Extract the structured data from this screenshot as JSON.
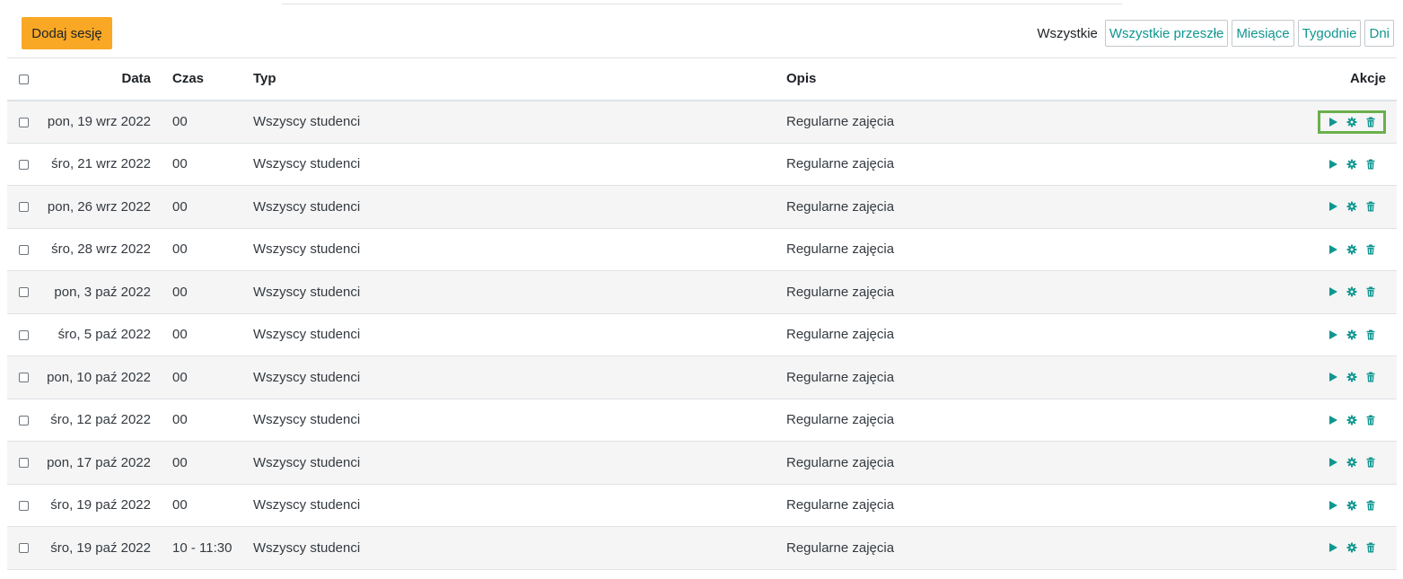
{
  "toolbar": {
    "add_session_label": "Dodaj sesję"
  },
  "filters": {
    "label": "Wszystkie",
    "buttons": [
      "Wszystkie przeszłe",
      "Miesiące",
      "Tygodnie",
      "Dni"
    ]
  },
  "table": {
    "headers": {
      "date": "Data",
      "time": "Czas",
      "type": "Typ",
      "description": "Opis",
      "actions": "Akcje"
    },
    "rows": [
      {
        "date": "pon, 19 wrz 2022",
        "time": "00",
        "type": "Wszyscy studenci",
        "description": "Regularne zajęcia"
      },
      {
        "date": "śro, 21 wrz 2022",
        "time": "00",
        "type": "Wszyscy studenci",
        "description": "Regularne zajęcia"
      },
      {
        "date": "pon, 26 wrz 2022",
        "time": "00",
        "type": "Wszyscy studenci",
        "description": "Regularne zajęcia"
      },
      {
        "date": "śro, 28 wrz 2022",
        "time": "00",
        "type": "Wszyscy studenci",
        "description": "Regularne zajęcia"
      },
      {
        "date": "pon, 3 paź 2022",
        "time": "00",
        "type": "Wszyscy studenci",
        "description": "Regularne zajęcia"
      },
      {
        "date": "śro, 5 paź 2022",
        "time": "00",
        "type": "Wszyscy studenci",
        "description": "Regularne zajęcia"
      },
      {
        "date": "pon, 10 paź 2022",
        "time": "00",
        "type": "Wszyscy studenci",
        "description": "Regularne zajęcia"
      },
      {
        "date": "śro, 12 paź 2022",
        "time": "00",
        "type": "Wszyscy studenci",
        "description": "Regularne zajęcia"
      },
      {
        "date": "pon, 17 paź 2022",
        "time": "00",
        "type": "Wszyscy studenci",
        "description": "Regularne zajęcia"
      },
      {
        "date": "śro, 19 paź 2022",
        "time": "00",
        "type": "Wszyscy studenci",
        "description": "Regularne zajęcia"
      },
      {
        "date": "śro, 19 paź 2022",
        "time": "10 - 11:30",
        "type": "Wszyscy studenci",
        "description": "Regularne zajęcia"
      }
    ],
    "row_action_icons": [
      "play-icon",
      "gear-icon",
      "trash-icon"
    ]
  },
  "colors": {
    "accent": "#0f9690",
    "add_button": "#f9a825",
    "highlight": "#6ab04c"
  }
}
